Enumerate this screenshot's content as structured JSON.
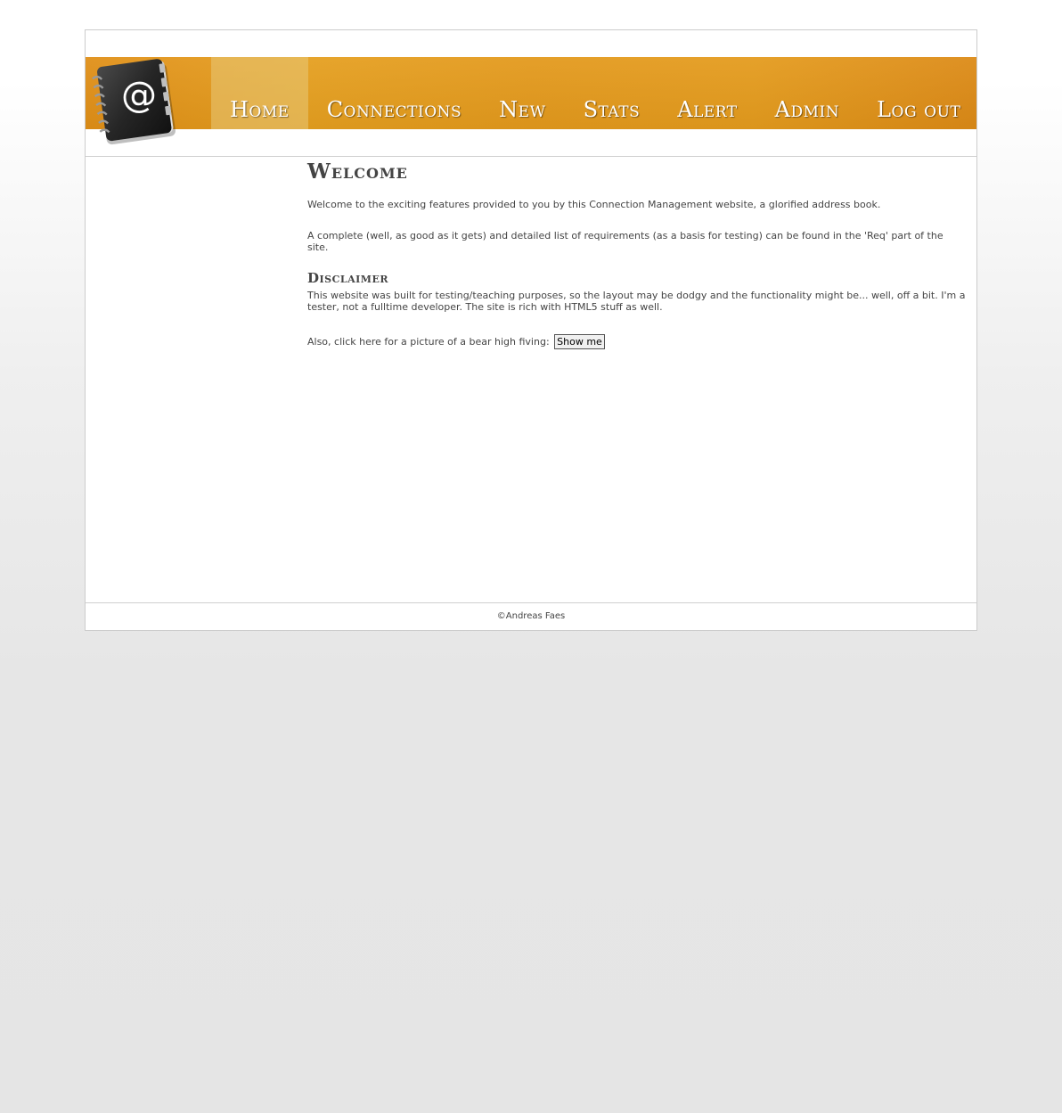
{
  "header": {
    "logo_icon": "address-book-at-icon",
    "logo_symbol": "@",
    "accent_color": "#e59a1d"
  },
  "nav": {
    "items": [
      {
        "label": "Home",
        "active": true
      },
      {
        "label": "Connections",
        "active": false
      },
      {
        "label": "New",
        "active": false
      },
      {
        "label": "Stats",
        "active": false
      },
      {
        "label": "Alert",
        "active": false
      },
      {
        "label": "Admin",
        "active": false
      },
      {
        "label": "Log out",
        "active": false
      }
    ]
  },
  "main": {
    "title": "Welcome",
    "intro": "Welcome to the exciting features provided to you by this Connection Management website, a glorified address book.",
    "requirements": "A complete (well, as good as it gets) and detailed list of requirements (as a basis for testing) can be found in the 'Req' part of the site.",
    "disclaimer_title": "Disclaimer",
    "disclaimer_text": "This website was built for testing/teaching purposes, so the layout may be dodgy and the functionality might be... well, off a bit. I'm a tester, not a fulltime developer. The site is rich with HTML5 stuff as well.",
    "bear_text": "Also, click here for a picture of a bear high fiving:",
    "show_me_label": "Show me"
  },
  "footer": {
    "copyright": "©Andreas Faes"
  }
}
